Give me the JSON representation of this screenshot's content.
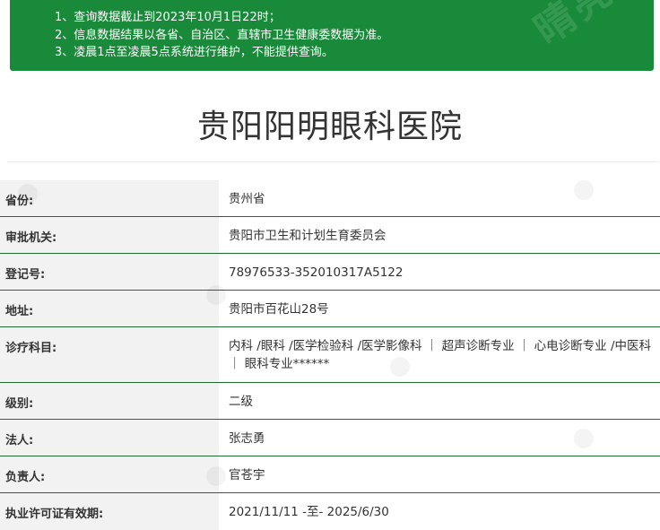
{
  "notice": {
    "lines": [
      "1、查询数据截止到2023年10月1日22时；",
      "2、信息数据结果以各省、自治区、直辖市卫生健康委数据为准。",
      "3、凌晨1点至凌晨5点系统进行维护，不能提供查询。"
    ],
    "watermark": "晴亮",
    "color": "#198a3a"
  },
  "hospital": {
    "name": "贵阳阳明眼科医院"
  },
  "fields": [
    {
      "label": "省份:",
      "value": "贵州省"
    },
    {
      "label": "审批机关:",
      "value": "贵阳市卫生和计划生育委员会"
    },
    {
      "label": "登记号:",
      "value": "78976533-352010317A5122"
    },
    {
      "label": "地址:",
      "value": "贵阳市百花山28号"
    },
    {
      "label": "诊疗科目:",
      "value": "内科 /眼科 /医学检验科 /医学影像科 ｜ 超声诊断专业 ｜ 心电诊断专业 /中医科 ｜ 眼科专业******"
    },
    {
      "label": "级别:",
      "value": "二级"
    },
    {
      "label": "法人:",
      "value": "张志勇"
    },
    {
      "label": "负责人:",
      "value": "官苍宇"
    },
    {
      "label": "执业许可证有效期:",
      "value": "2021/11/11 -至- 2025/6/30"
    }
  ]
}
